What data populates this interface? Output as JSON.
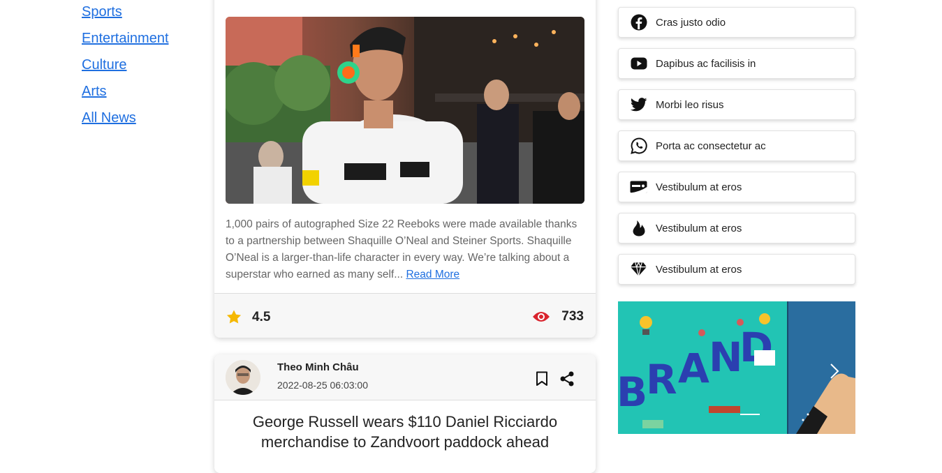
{
  "nav": {
    "items": [
      {
        "label": "Sports"
      },
      {
        "label": "Entertainment"
      },
      {
        "label": "Culture"
      },
      {
        "label": "Arts"
      },
      {
        "label": "All News"
      }
    ]
  },
  "article1": {
    "excerpt": "1,000 pairs of autographed Size 22 Reeboks were made available thanks to a partnership between Shaquille O’Neal and Steiner Sports. Shaquille O’Neal is a larger-than-life character in every way. We’re talking about a superstar who earned as many self...",
    "read_more": "Read More",
    "rating": "4.5",
    "views": "733"
  },
  "article2": {
    "author": "Theo Minh Châu",
    "date": "2022-08-25 06:03:00",
    "title": "George Russell wears $110 Daniel Ricciardo merchandise to Zandvoort paddock ahead"
  },
  "social": [
    {
      "icon": "facebook-icon",
      "label": "Cras justo odio"
    },
    {
      "icon": "youtube-icon",
      "label": "Dapibus ac facilisis in"
    },
    {
      "icon": "twitter-icon",
      "label": "Morbi leo risus"
    },
    {
      "icon": "whatsapp-icon",
      "label": "Porta ac consectetur ac"
    },
    {
      "icon": "discover-card-icon",
      "label": "Vestibulum at eros"
    },
    {
      "icon": "tinder-flame-icon",
      "label": "Vestibulum at eros"
    },
    {
      "icon": "diamond-icon",
      "label": "Vestibulum at eros"
    }
  ],
  "banner": {
    "letters": [
      "B",
      "R",
      "A",
      "N",
      "D"
    ]
  },
  "colors": {
    "link": "#1f6fe0",
    "star": "#f5b800",
    "eye": "#d9232d",
    "banner_bg": "#22c4b4",
    "banner_side": "#2a6d9f"
  }
}
